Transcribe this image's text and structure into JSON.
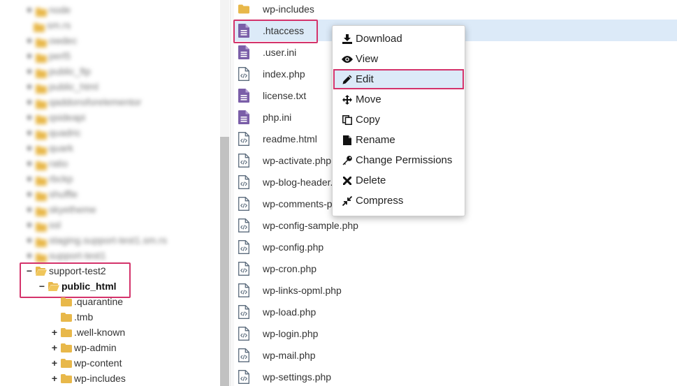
{
  "tree": {
    "blurred_items": [
      {
        "label": "node",
        "toggle": "+"
      },
      {
        "label": "sm.rs",
        "toggle": ""
      },
      {
        "label": "owdec",
        "toggle": "+"
      },
      {
        "label": "perl5",
        "toggle": "+"
      },
      {
        "label": "public_ftp",
        "toggle": "+"
      },
      {
        "label": "public_html",
        "toggle": "+"
      },
      {
        "label": "qaddonsforelementor",
        "toggle": "+"
      },
      {
        "label": "qsideapi",
        "toggle": "+"
      },
      {
        "label": "quadric",
        "toggle": "+"
      },
      {
        "label": "quark",
        "toggle": "+"
      },
      {
        "label": "ratio",
        "toggle": "+"
      },
      {
        "label": "rbckp",
        "toggle": "+"
      },
      {
        "label": "shuffle",
        "toggle": "+"
      },
      {
        "label": "skyetheme",
        "toggle": "+"
      },
      {
        "label": "ssl",
        "toggle": "+"
      },
      {
        "label": "staging.support-test1.sm.rs",
        "toggle": "+"
      },
      {
        "label": "support-test1",
        "toggle": "+"
      }
    ],
    "items": [
      {
        "label": "support-test2",
        "toggle": "−"
      },
      {
        "label": "public_html",
        "toggle": "−"
      },
      {
        "label": ".quarantine",
        "toggle": ""
      },
      {
        "label": ".tmb",
        "toggle": ""
      },
      {
        "label": ".well-known",
        "toggle": "+"
      },
      {
        "label": "wp-admin",
        "toggle": "+"
      },
      {
        "label": "wp-content",
        "toggle": "+"
      },
      {
        "label": "wp-includes",
        "toggle": "+"
      }
    ]
  },
  "files": [
    {
      "name": "wp-includes",
      "icon": "folder-icon"
    },
    {
      "name": ".htaccess",
      "icon": "text-file-icon"
    },
    {
      "name": ".user.ini",
      "icon": "text-file-icon"
    },
    {
      "name": "index.php",
      "icon": "code-file-icon"
    },
    {
      "name": "license.txt",
      "icon": "text-file-icon"
    },
    {
      "name": "php.ini",
      "icon": "text-file-icon"
    },
    {
      "name": "readme.html",
      "icon": "code-file-icon"
    },
    {
      "name": "wp-activate.php",
      "icon": "code-file-icon"
    },
    {
      "name": "wp-blog-header.php",
      "icon": "code-file-icon"
    },
    {
      "name": "wp-comments-post.php",
      "icon": "code-file-icon"
    },
    {
      "name": "wp-config-sample.php",
      "icon": "code-file-icon"
    },
    {
      "name": "wp-config.php",
      "icon": "code-file-icon"
    },
    {
      "name": "wp-cron.php",
      "icon": "code-file-icon"
    },
    {
      "name": "wp-links-opml.php",
      "icon": "code-file-icon"
    },
    {
      "name": "wp-load.php",
      "icon": "code-file-icon"
    },
    {
      "name": "wp-login.php",
      "icon": "code-file-icon"
    },
    {
      "name": "wp-mail.php",
      "icon": "code-file-icon"
    },
    {
      "name": "wp-settings.php",
      "icon": "code-file-icon"
    }
  ],
  "context_menu": {
    "items": [
      {
        "label": "Download",
        "icon": "download-icon"
      },
      {
        "label": "View",
        "icon": "eye-icon"
      },
      {
        "label": "Edit",
        "icon": "pencil-icon"
      },
      {
        "label": "Move",
        "icon": "move-arrows-icon"
      },
      {
        "label": "Copy",
        "icon": "copy-icon"
      },
      {
        "label": "Rename",
        "icon": "file-icon"
      },
      {
        "label": "Change Permissions",
        "icon": "key-icon"
      },
      {
        "label": "Delete",
        "icon": "x-icon"
      },
      {
        "label": "Compress",
        "icon": "compress-icon"
      }
    ]
  },
  "colors": {
    "folder": "#e8b84a",
    "text_file": "#7a5ea8",
    "selection": "#dceaf8",
    "highlight_border": "#d4336b"
  }
}
